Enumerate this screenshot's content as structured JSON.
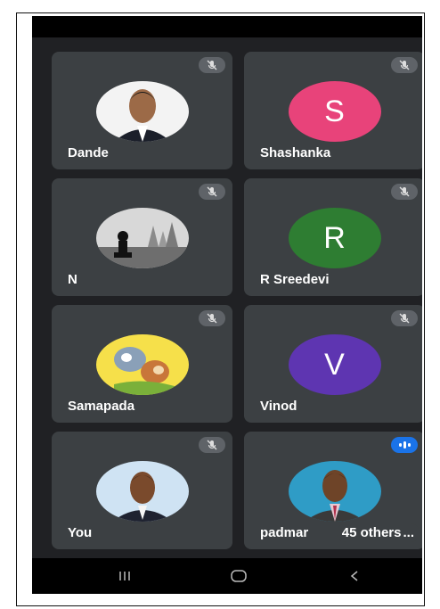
{
  "participants": [
    {
      "name": "Dande",
      "avatar_type": "photo",
      "muted": true
    },
    {
      "name": "Shashanka",
      "avatar_type": "letter",
      "letter": "S",
      "color": "#e8437a",
      "muted": true
    },
    {
      "name": "N",
      "avatar_type": "photo",
      "muted": true
    },
    {
      "name": "R Sreedevi",
      "avatar_type": "letter",
      "letter": "R",
      "color": "#2e7d32",
      "muted": true
    },
    {
      "name": "Samapada",
      "avatar_type": "photo",
      "muted": true
    },
    {
      "name": "Vinod",
      "avatar_type": "letter",
      "letter": "V",
      "color": "#5e35b1",
      "muted": true
    },
    {
      "name": "You",
      "avatar_type": "photo",
      "muted": true
    },
    {
      "name": "padmar",
      "avatar_type": "photo",
      "muted": false,
      "speaking": true
    }
  ],
  "others_badge": "45 others",
  "trailing_dots": "...",
  "icons": {
    "mute": "mic-off-icon",
    "speaking": "speaking-indicator-icon",
    "nav_recents": "recents-icon",
    "nav_home": "home-icon",
    "nav_back": "back-icon"
  },
  "colors": {
    "background": "#202124",
    "tile": "#3c4043",
    "accent": "#1a73e8"
  }
}
